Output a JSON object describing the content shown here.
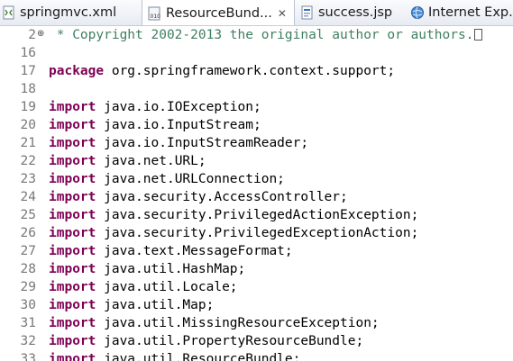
{
  "tabs": [
    {
      "label": "springmvc.xml",
      "icon": "xml-file-icon",
      "active": false
    },
    {
      "label": "ResourceBund...",
      "icon": "class-file-icon",
      "active": true,
      "close": "✕"
    },
    {
      "label": "success.jsp",
      "icon": "jsp-file-icon",
      "active": false
    },
    {
      "label": "Internet Exp...",
      "icon": "web-browser-icon",
      "active": false
    }
  ],
  "editor": {
    "lines": [
      {
        "num": "2",
        "fold": "⊕",
        "segments": [
          {
            "t": "comment",
            "v": " * Copyright 2002-2013 the original author or authors."
          }
        ],
        "folded_marker": true
      },
      {
        "num": "16",
        "segments": []
      },
      {
        "num": "17",
        "segments": [
          {
            "t": "keyword",
            "v": "package"
          },
          {
            "t": "plain",
            "v": " org.springframework.context.support;"
          }
        ]
      },
      {
        "num": "18",
        "segments": []
      },
      {
        "num": "19",
        "segments": [
          {
            "t": "keyword",
            "v": "import"
          },
          {
            "t": "plain",
            "v": " java.io.IOException;"
          }
        ]
      },
      {
        "num": "20",
        "segments": [
          {
            "t": "keyword",
            "v": "import"
          },
          {
            "t": "plain",
            "v": " java.io.InputStream;"
          }
        ]
      },
      {
        "num": "21",
        "segments": [
          {
            "t": "keyword",
            "v": "import"
          },
          {
            "t": "plain",
            "v": " java.io.InputStreamReader;"
          }
        ]
      },
      {
        "num": "22",
        "segments": [
          {
            "t": "keyword",
            "v": "import"
          },
          {
            "t": "plain",
            "v": " java.net.URL;"
          }
        ]
      },
      {
        "num": "23",
        "segments": [
          {
            "t": "keyword",
            "v": "import"
          },
          {
            "t": "plain",
            "v": " java.net.URLConnection;"
          }
        ]
      },
      {
        "num": "24",
        "segments": [
          {
            "t": "keyword",
            "v": "import"
          },
          {
            "t": "plain",
            "v": " java.security.AccessController;"
          }
        ]
      },
      {
        "num": "25",
        "segments": [
          {
            "t": "keyword",
            "v": "import"
          },
          {
            "t": "plain",
            "v": " java.security.PrivilegedActionException;"
          }
        ]
      },
      {
        "num": "26",
        "segments": [
          {
            "t": "keyword",
            "v": "import"
          },
          {
            "t": "plain",
            "v": " java.security.PrivilegedExceptionAction;"
          }
        ]
      },
      {
        "num": "27",
        "segments": [
          {
            "t": "keyword",
            "v": "import"
          },
          {
            "t": "plain",
            "v": " java.text.MessageFormat;"
          }
        ]
      },
      {
        "num": "28",
        "segments": [
          {
            "t": "keyword",
            "v": "import"
          },
          {
            "t": "plain",
            "v": " java.util.HashMap;"
          }
        ]
      },
      {
        "num": "29",
        "segments": [
          {
            "t": "keyword",
            "v": "import"
          },
          {
            "t": "plain",
            "v": " java.util.Locale;"
          }
        ]
      },
      {
        "num": "30",
        "segments": [
          {
            "t": "keyword",
            "v": "import"
          },
          {
            "t": "plain",
            "v": " java.util.Map;"
          }
        ]
      },
      {
        "num": "31",
        "segments": [
          {
            "t": "keyword",
            "v": "import"
          },
          {
            "t": "plain",
            "v": " java.util.MissingResourceException;"
          }
        ]
      },
      {
        "num": "32",
        "segments": [
          {
            "t": "keyword",
            "v": "import"
          },
          {
            "t": "plain",
            "v": " java.util.PropertyResourceBundle;"
          }
        ]
      },
      {
        "num": "33",
        "segments": [
          {
            "t": "keyword",
            "v": "import"
          },
          {
            "t": "plain",
            "v": " java.util.ResourceBundle;"
          }
        ]
      }
    ]
  },
  "colors": {
    "keyword": "#7f0055",
    "comment": "#3f7f5f",
    "line_number": "#787878",
    "plain": "#000000"
  }
}
